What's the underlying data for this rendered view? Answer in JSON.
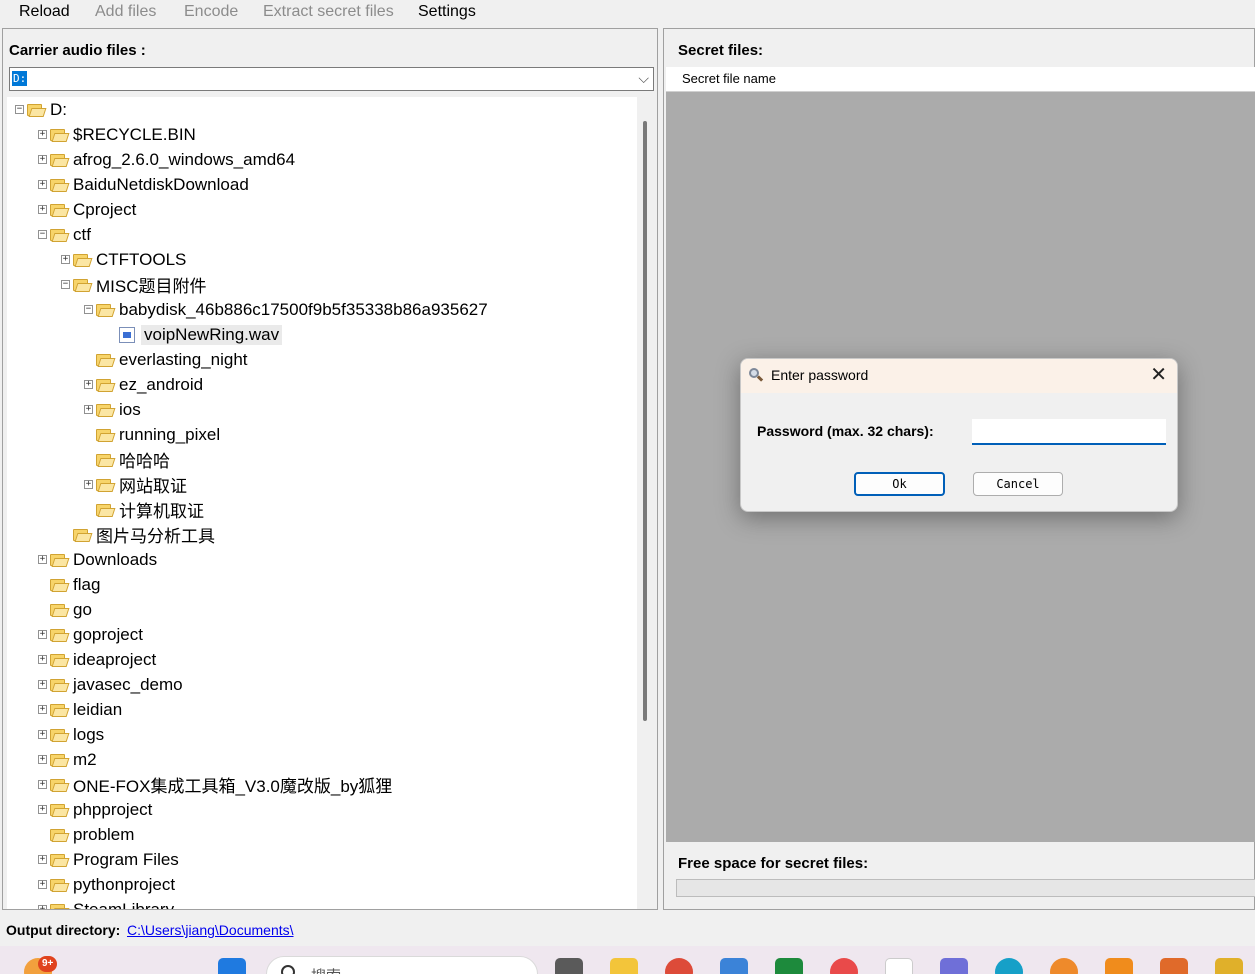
{
  "menu": {
    "reload": "Reload",
    "add_files": "Add files",
    "encode": "Encode",
    "extract": "Extract secret files",
    "settings": "Settings"
  },
  "left": {
    "title": "Carrier audio files :",
    "drive_value": "D:",
    "tree": [
      {
        "label": "D:",
        "expander": "minus",
        "type": "folder"
      },
      {
        "label": "$RECYCLE.BIN",
        "expander": "plus",
        "type": "folder"
      },
      {
        "label": "afrog_2.6.0_windows_amd64",
        "expander": "plus",
        "type": "folder"
      },
      {
        "label": "BaiduNetdiskDownload",
        "expander": "plus",
        "type": "folder"
      },
      {
        "label": "Cproject",
        "expander": "plus",
        "type": "folder"
      },
      {
        "label": "ctf",
        "expander": "minus",
        "type": "folder"
      },
      {
        "label": "CTFTOOLS",
        "expander": "plus",
        "type": "folder"
      },
      {
        "label": "MISC题目附件",
        "expander": "minus",
        "type": "folder"
      },
      {
        "label": "babydisk_46b886c17500f9b5f35338b86a935627",
        "expander": "minus",
        "type": "folder"
      },
      {
        "label": "voipNewRing.wav",
        "expander": "none",
        "type": "file",
        "selected": true
      },
      {
        "label": "everlasting_night",
        "expander": "none",
        "type": "folder"
      },
      {
        "label": "ez_android",
        "expander": "plus",
        "type": "folder"
      },
      {
        "label": "ios",
        "expander": "plus",
        "type": "folder"
      },
      {
        "label": "running_pixel",
        "expander": "none",
        "type": "folder"
      },
      {
        "label": "哈哈哈",
        "expander": "none",
        "type": "folder"
      },
      {
        "label": "网站取证",
        "expander": "plus",
        "type": "folder"
      },
      {
        "label": "计算机取证",
        "expander": "none",
        "type": "folder"
      },
      {
        "label": "图片马分析工具",
        "expander": "none",
        "type": "folder"
      },
      {
        "label": "Downloads",
        "expander": "plus",
        "type": "folder"
      },
      {
        "label": "flag",
        "expander": "none",
        "type": "folder"
      },
      {
        "label": "go",
        "expander": "none",
        "type": "folder"
      },
      {
        "label": "goproject",
        "expander": "plus",
        "type": "folder"
      },
      {
        "label": "ideaproject",
        "expander": "plus",
        "type": "folder"
      },
      {
        "label": "javasec_demo",
        "expander": "plus",
        "type": "folder"
      },
      {
        "label": "leidian",
        "expander": "plus",
        "type": "folder"
      },
      {
        "label": "logs",
        "expander": "plus",
        "type": "folder"
      },
      {
        "label": "m2",
        "expander": "plus",
        "type": "folder"
      },
      {
        "label": "ONE-FOX集成工具箱_V3.0魔改版_by狐狸",
        "expander": "plus",
        "type": "folder"
      },
      {
        "label": "phpproject",
        "expander": "plus",
        "type": "folder"
      },
      {
        "label": "problem",
        "expander": "none",
        "type": "folder"
      },
      {
        "label": "Program Files",
        "expander": "plus",
        "type": "folder"
      },
      {
        "label": "pythonproject",
        "expander": "plus",
        "type": "folder"
      },
      {
        "label": "SteamLibrary",
        "expander": "plus",
        "type": "folder"
      }
    ]
  },
  "right": {
    "title": "Secret files:",
    "column_header": "Secret file name",
    "free_space_title": "Free space for secret files:"
  },
  "status": {
    "label": "Output directory:",
    "path": "C:\\Users\\jiang\\Documents\\"
  },
  "taskbar": {
    "badge": "9+",
    "search_text": "搜索"
  },
  "dialog": {
    "title": "Enter password",
    "close_glyph": "✕",
    "label": "Password (max. 32 chars):",
    "password_value": "",
    "ok": "Ok",
    "cancel": "Cancel"
  }
}
